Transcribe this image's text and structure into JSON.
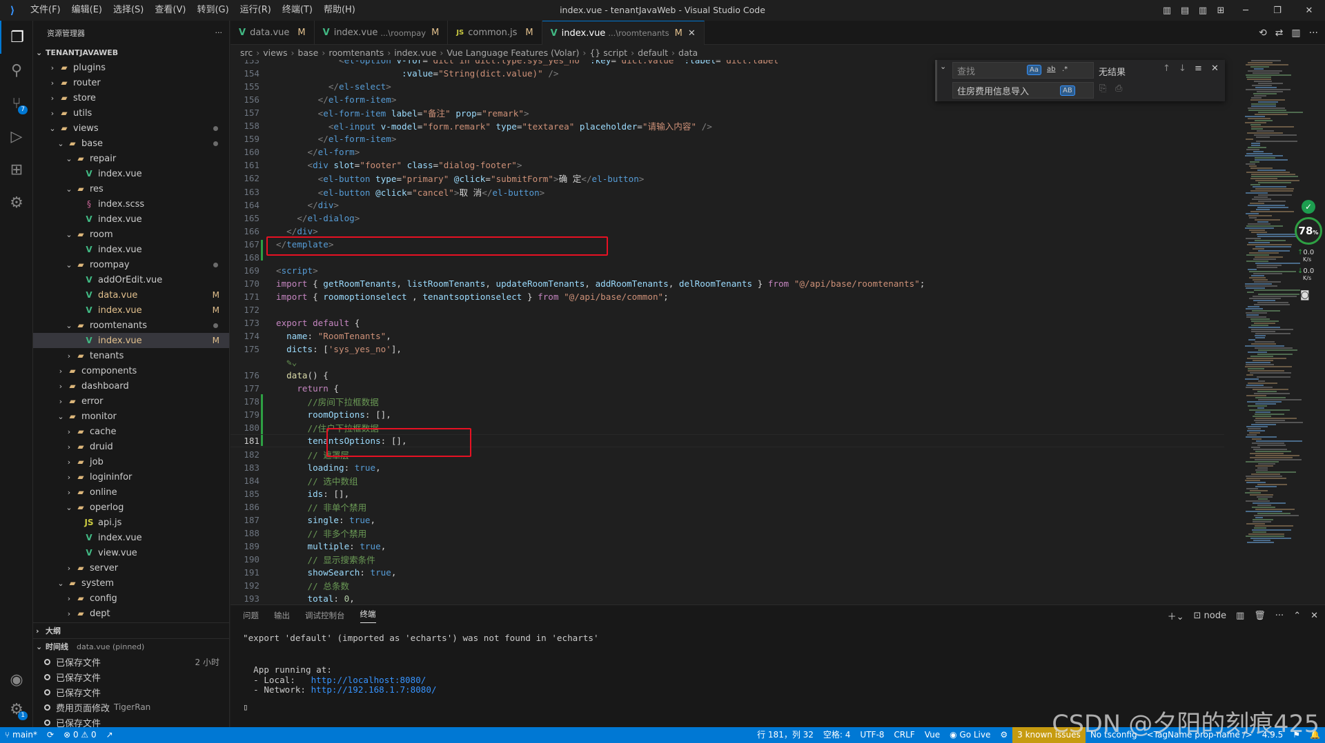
{
  "window": {
    "title": "index.vue - tenantJavaWeb - Visual Studio Code"
  },
  "menu": [
    "文件(F)",
    "编辑(E)",
    "选择(S)",
    "查看(V)",
    "转到(G)",
    "运行(R)",
    "终端(T)",
    "帮助(H)"
  ],
  "sidebar": {
    "title": "资源管理器",
    "project": "TENANTJAVAWEB",
    "tree": [
      {
        "label": "plugins",
        "depth": 2,
        "kind": "folder",
        "chev": "›"
      },
      {
        "label": "router",
        "depth": 2,
        "kind": "folder",
        "chev": "›"
      },
      {
        "label": "store",
        "depth": 2,
        "kind": "folder",
        "chev": "›"
      },
      {
        "label": "utils",
        "depth": 2,
        "kind": "folder",
        "chev": "›"
      },
      {
        "label": "views",
        "depth": 2,
        "kind": "folder",
        "chev": "⌄",
        "dot": true
      },
      {
        "label": "base",
        "depth": 3,
        "kind": "folder",
        "chev": "⌄",
        "dot": true
      },
      {
        "label": "repair",
        "depth": 4,
        "kind": "folder",
        "chev": "⌄"
      },
      {
        "label": "index.vue",
        "depth": 5,
        "kind": "vue"
      },
      {
        "label": "res",
        "depth": 4,
        "kind": "folder",
        "chev": "⌄"
      },
      {
        "label": "index.scss",
        "depth": 5,
        "kind": "scss"
      },
      {
        "label": "index.vue",
        "depth": 5,
        "kind": "vue"
      },
      {
        "label": "room",
        "depth": 4,
        "kind": "folder",
        "chev": "⌄"
      },
      {
        "label": "index.vue",
        "depth": 5,
        "kind": "vue"
      },
      {
        "label": "roompay",
        "depth": 4,
        "kind": "folder",
        "chev": "⌄",
        "dot": true
      },
      {
        "label": "addOrEdit.vue",
        "depth": 5,
        "kind": "vue"
      },
      {
        "label": "data.vue",
        "depth": 5,
        "kind": "vue",
        "mod": "M"
      },
      {
        "label": "index.vue",
        "depth": 5,
        "kind": "vue",
        "mod": "M"
      },
      {
        "label": "roomtenants",
        "depth": 4,
        "kind": "folder",
        "chev": "⌄",
        "dot": true
      },
      {
        "label": "index.vue",
        "depth": 5,
        "kind": "vue",
        "mod": "M",
        "selected": true
      },
      {
        "label": "tenants",
        "depth": 4,
        "kind": "folder",
        "chev": "›"
      },
      {
        "label": "components",
        "depth": 3,
        "kind": "folder",
        "chev": "›"
      },
      {
        "label": "dashboard",
        "depth": 3,
        "kind": "folder",
        "chev": "›"
      },
      {
        "label": "error",
        "depth": 3,
        "kind": "folder",
        "chev": "›"
      },
      {
        "label": "monitor",
        "depth": 3,
        "kind": "folder",
        "chev": "⌄"
      },
      {
        "label": "cache",
        "depth": 4,
        "kind": "folder",
        "chev": "›"
      },
      {
        "label": "druid",
        "depth": 4,
        "kind": "folder",
        "chev": "›"
      },
      {
        "label": "job",
        "depth": 4,
        "kind": "folder",
        "chev": "›"
      },
      {
        "label": "logininfor",
        "depth": 4,
        "kind": "folder",
        "chev": "›"
      },
      {
        "label": "online",
        "depth": 4,
        "kind": "folder",
        "chev": "›"
      },
      {
        "label": "operlog",
        "depth": 4,
        "kind": "folder",
        "chev": "⌄"
      },
      {
        "label": "api.js",
        "depth": 5,
        "kind": "js"
      },
      {
        "label": "index.vue",
        "depth": 5,
        "kind": "vue"
      },
      {
        "label": "view.vue",
        "depth": 5,
        "kind": "vue"
      },
      {
        "label": "server",
        "depth": 4,
        "kind": "folder",
        "chev": "›"
      },
      {
        "label": "system",
        "depth": 3,
        "kind": "folder",
        "chev": "⌄"
      },
      {
        "label": "config",
        "depth": 4,
        "kind": "folder",
        "chev": "›"
      },
      {
        "label": "dept",
        "depth": 4,
        "kind": "folder",
        "chev": "›"
      }
    ],
    "outline_title": "大纲",
    "timeline_title": "时间线",
    "timeline_pinned": "data.vue (pinned)",
    "timeline": [
      {
        "label": "已保存文件",
        "time": "2 小时"
      },
      {
        "label": "已保存文件",
        "time": ""
      },
      {
        "label": "已保存文件",
        "time": ""
      },
      {
        "label": "费用页面修改",
        "author": "TigerRan",
        "time": ""
      },
      {
        "label": "已保存文件",
        "time": ""
      },
      {
        "label": "已保存文件",
        "time": ""
      }
    ]
  },
  "tabs": [
    {
      "name": "data.vue",
      "path": "",
      "mod": "M",
      "kind": "vue"
    },
    {
      "name": "index.vue",
      "path": "...\\roompay",
      "mod": "M",
      "kind": "vue"
    },
    {
      "name": "common.js",
      "path": "",
      "mod": "M",
      "kind": "js"
    },
    {
      "name": "index.vue",
      "path": "...\\roomtenants",
      "mod": "M",
      "kind": "vue",
      "active": true
    }
  ],
  "breadcrumb": [
    "src",
    "views",
    "base",
    "roomtenants",
    "index.vue",
    "Vue Language Features (Volar)",
    "{} script",
    "default",
    "data"
  ],
  "find": {
    "placeholder": "查找",
    "result": "无结果",
    "replace_value": "住房费用信息导入",
    "opt_case": "Aa",
    "opt_word": "ab",
    "opt_regex": ".*",
    "opt_preserve": "AB"
  },
  "editor": {
    "current_line": 181
  },
  "panel": {
    "tabs": [
      "问题",
      "输出",
      "调试控制台",
      "终端"
    ],
    "active_tab": "终端",
    "shell": "node",
    "terminal_lines": [
      {
        "text": "\"export 'default' (imported as 'echarts') was not found in 'echarts'"
      },
      {
        "text": ""
      },
      {
        "text": "  App running at:"
      },
      {
        "text": "  - Local:   ",
        "link": "http://localhost:8080/"
      },
      {
        "text": "  - Network: ",
        "link": "http://192.168.1.7:8080/"
      }
    ],
    "prompt": "▯"
  },
  "status": {
    "branch": "main*",
    "errors": "0",
    "warnings": "0",
    "position": "行 181，列 32",
    "spaces": "空格: 4",
    "encoding": "UTF-8",
    "eol": "CRLF",
    "language": "Vue",
    "golive": "Go Live",
    "issues": "3 known issues",
    "tsconfig": "No tsconfig",
    "tagname": "<TagName prop-name />",
    "version": "4.9.5"
  },
  "widget": {
    "percent": "78",
    "unit": "%",
    "up": "0.0",
    "down": "0.0",
    "rate": "K/s"
  },
  "watermark": "CSDN @夕阳的刻痕425",
  "colors": {
    "accent": "#0078d4",
    "highlight_box": "#e81123",
    "modified": "#e2c08d",
    "added_gutter": "#2ea043"
  }
}
